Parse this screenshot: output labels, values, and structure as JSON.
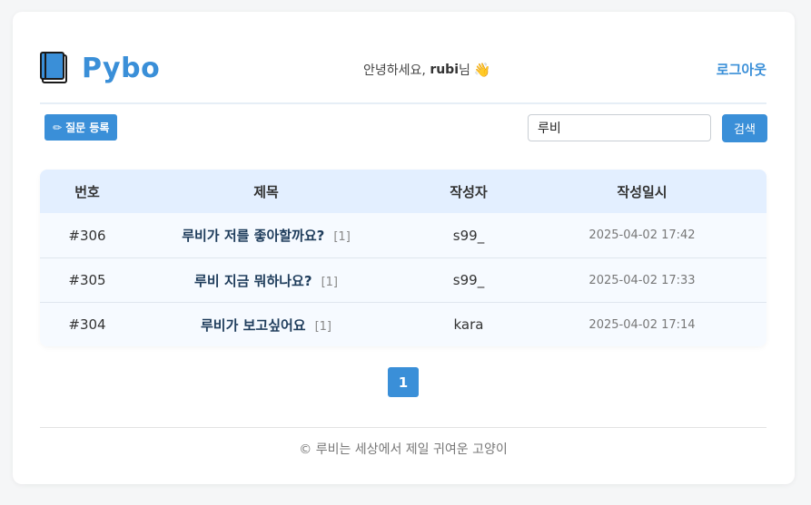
{
  "brand": {
    "name": "Pybo",
    "color": "#3a8fd8",
    "icon": "book-icon"
  },
  "header": {
    "greeting_prefix": "안녕하세요, ",
    "username": "rubi",
    "greeting_suffix": "님",
    "greeting_icon": "👋",
    "logout_label": "로그아웃"
  },
  "toolbar": {
    "ask_label": "질문 등록",
    "ask_icon": "✏",
    "search_value": "루비",
    "search_button": "검색"
  },
  "table": {
    "headers": {
      "num": "번호",
      "title": "제목",
      "author": "작성자",
      "date": "작성일시"
    },
    "rows": [
      {
        "num": "#306",
        "title": "루비가 저를 좋아할까요?",
        "comments": "[1]",
        "author": "s99_",
        "date": "2025-04-02 17:42"
      },
      {
        "num": "#305",
        "title": "루비 지금 뭐하나요?",
        "comments": "[1]",
        "author": "s99_",
        "date": "2025-04-02 17:33"
      },
      {
        "num": "#304",
        "title": "루비가 보고싶어요",
        "comments": "[1]",
        "author": "kara",
        "date": "2025-04-02 17:14"
      }
    ]
  },
  "pagination": {
    "current": "1"
  },
  "footer": {
    "text": "© 루비는 세상에서 제일 귀여운 고양이"
  }
}
